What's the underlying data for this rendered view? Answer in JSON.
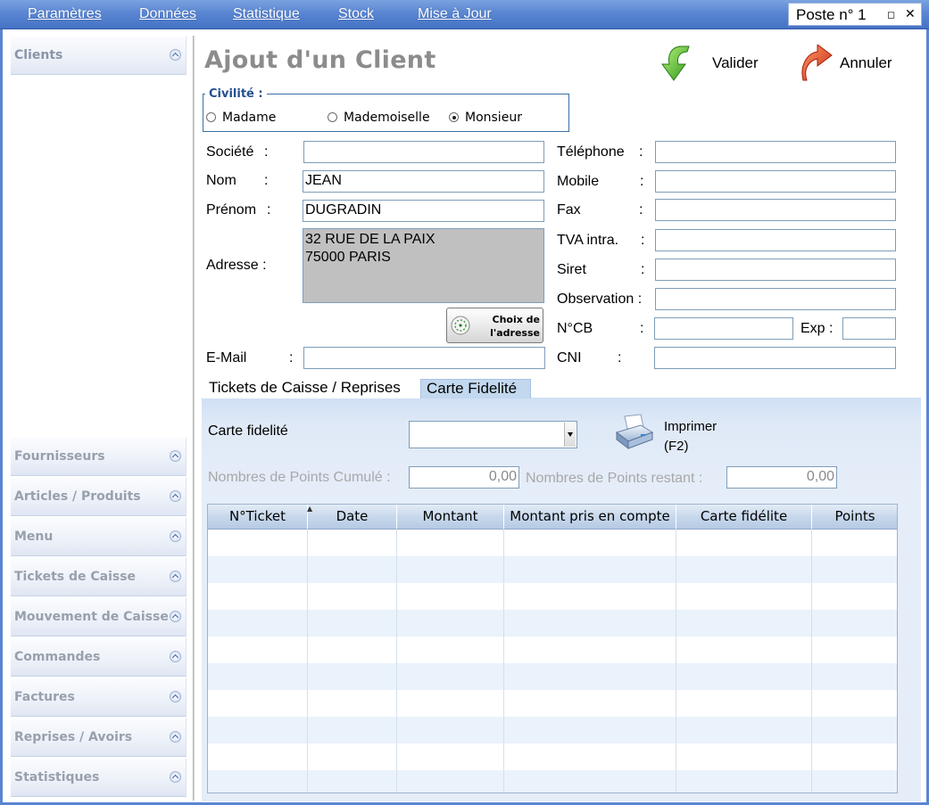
{
  "menubar": {
    "items": [
      "Paramètres",
      "Données",
      "Statistique",
      "Stock",
      "Mise à Jour"
    ],
    "window_title": "Poste n° 1"
  },
  "sidebar": {
    "items": [
      {
        "label": "Clients"
      },
      {
        "label": "Fournisseurs"
      },
      {
        "label": "Articles / Produits"
      },
      {
        "label": "Menu"
      },
      {
        "label": "Tickets de Caisse"
      },
      {
        "label": "Mouvement de Caisse"
      },
      {
        "label": "Commandes"
      },
      {
        "label": "Factures"
      },
      {
        "label": "Reprises / Avoirs"
      },
      {
        "label": "Statistiques"
      }
    ]
  },
  "form": {
    "title": "Ajout d'un Client",
    "valider_label": "Valider",
    "annuler_label": "Annuler",
    "civilite": {
      "legend": "Civilité :",
      "options": [
        "Madame",
        "Mademoiselle",
        "Monsieur"
      ],
      "selected": "Monsieur"
    },
    "left_fields": {
      "societe": {
        "label": "Société",
        "value": ""
      },
      "nom": {
        "label": "Nom",
        "value": "JEAN"
      },
      "prenom": {
        "label": "Prénom",
        "value": "DUGRADIN"
      },
      "adresse": {
        "label": "Adresse :",
        "line1": "32 RUE DE LA PAIX",
        "line2": "75000 PARIS"
      },
      "email": {
        "label": "E-Mail",
        "value": ""
      }
    },
    "choix_adresse_label": "Choix de l'adresse",
    "right_fields": {
      "telephone": {
        "label": "Téléphone",
        "value": ""
      },
      "mobile": {
        "label": "Mobile",
        "value": ""
      },
      "fax": {
        "label": "Fax",
        "value": ""
      },
      "tva": {
        "label": "TVA intra.",
        "value": ""
      },
      "siret": {
        "label": "Siret",
        "value": ""
      },
      "observation": {
        "label": "Observation :",
        "value": ""
      },
      "ncb": {
        "label": "N°CB",
        "value": ""
      },
      "exp": {
        "label": "Exp :",
        "value": ""
      },
      "cni": {
        "label": "CNI",
        "value": ""
      }
    },
    "colon": ":"
  },
  "tabs": {
    "items": [
      "Tickets de Caisse / Reprises",
      "Carte Fidelité"
    ],
    "active": "Carte Fidelité"
  },
  "fidelite": {
    "carte_label": "Carte fidelité",
    "carte_value": "",
    "imprimer_label": "Imprimer",
    "imprimer_shortcut": "(F2)",
    "points_cumules_label": "Nombres de Points Cumulé :",
    "points_cumules_value": "0,00",
    "points_restant_label": "Nombres de Points restant :",
    "points_restant_value": "0,00"
  },
  "grid": {
    "columns": [
      "N°Ticket",
      "Date",
      "Montant",
      "Montant pris en compte",
      "Carte fidélite",
      "Points"
    ],
    "rows": []
  },
  "colors": {
    "menubar": "#5a86d2",
    "tab_active": "#c2d8ef",
    "panel": "#dde8f6",
    "address_bg": "#c0c0c0"
  }
}
